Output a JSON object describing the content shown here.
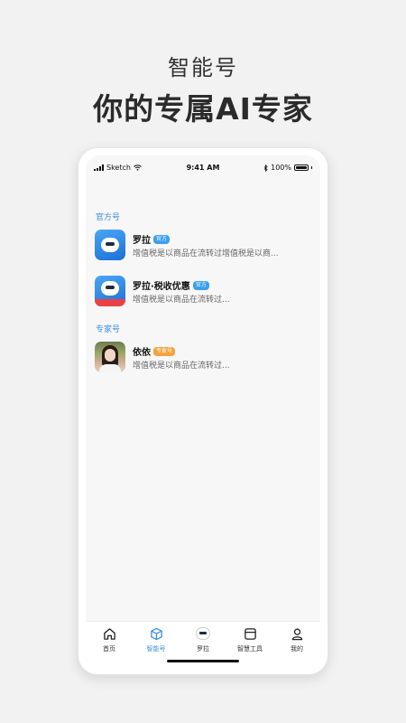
{
  "promo": {
    "subtitle": "智能号",
    "title": "你的专属AI专家"
  },
  "status_bar": {
    "carrier": "Sketch",
    "time": "9:41 AM",
    "battery": "100%"
  },
  "sections": {
    "official": "官方号",
    "expert": "专家号"
  },
  "official_items": [
    {
      "name": "罗拉",
      "badge": "官方",
      "desc": "增值税是以商品在流转过增值税是以商..."
    },
    {
      "name": "罗拉·税收优惠",
      "badge": "官方",
      "desc": "增值税是以商品在流转过..."
    }
  ],
  "expert_items": [
    {
      "name": "依依",
      "badge": "专家号",
      "desc": "增值税是以商品在流转过..."
    }
  ],
  "tab_bar": {
    "tabs": [
      {
        "label": "首页",
        "icon": "home-icon"
      },
      {
        "label": "智能号",
        "icon": "cube-icon"
      },
      {
        "label": "罗拉",
        "icon": "robot-icon"
      },
      {
        "label": "智慧工具",
        "icon": "toolbox-icon"
      },
      {
        "label": "我的",
        "icon": "user-icon"
      }
    ],
    "active_index": 1
  },
  "colors": {
    "accent": "#3b8fe0",
    "badge_official": "#3b9ff0",
    "badge_expert": "#f4a23b"
  }
}
